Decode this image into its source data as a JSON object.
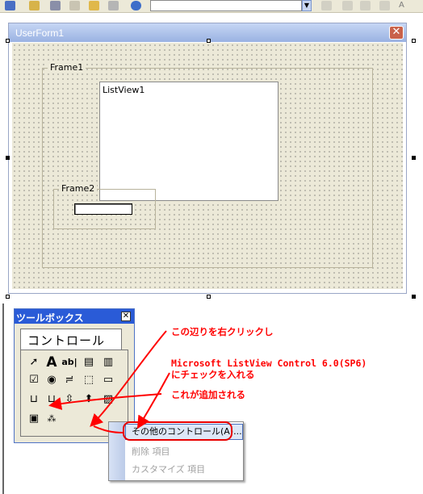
{
  "toolbar": {
    "icons": [
      "form-icon",
      "edit-icon",
      "wrench-icon",
      "properties-icon",
      "folder-icon",
      "cut-icon",
      "help-icon"
    ],
    "right_icons": [
      "align-left-icon",
      "align-right-icon",
      "align-top-icon",
      "font-size-icon"
    ],
    "font_size_glyph": "A",
    "dropdown_glyph": "▼"
  },
  "userform": {
    "title": "UserForm1",
    "close_glyph": "✕",
    "frame1_label": "Frame1",
    "listview_label": "ListView1",
    "frame2_label": "Frame2"
  },
  "toolbox": {
    "title": "ツールボックス",
    "close_glyph": "✕",
    "tab_label": "コントロール",
    "tools": [
      {
        "name": "pointer-tool",
        "glyph": "➚"
      },
      {
        "name": "label-tool",
        "glyph": "A"
      },
      {
        "name": "textbox-tool",
        "glyph": "ab|"
      },
      {
        "name": "combobox-tool",
        "glyph": "▤"
      },
      {
        "name": "listbox-tool",
        "glyph": "▥"
      },
      {
        "name": "checkbox-tool",
        "glyph": "☑"
      },
      {
        "name": "option-button-tool",
        "glyph": "◉"
      },
      {
        "name": "toggle-button-tool",
        "glyph": "≓"
      },
      {
        "name": "frame-tool",
        "glyph": "⬚"
      },
      {
        "name": "command-button-tool",
        "glyph": "▭"
      },
      {
        "name": "tabstrip-tool",
        "glyph": "⊔"
      },
      {
        "name": "multipage-tool",
        "glyph": "⊔"
      },
      {
        "name": "scrollbar-tool",
        "glyph": "⇳"
      },
      {
        "name": "spin-button-tool",
        "glyph": "⬍"
      },
      {
        "name": "image-tool",
        "glyph": "▨"
      },
      {
        "name": "refedit-tool",
        "glyph": "▣"
      },
      {
        "name": "listview-tool",
        "glyph": "⁂"
      }
    ]
  },
  "context_menu": {
    "items": [
      {
        "label": "その他のコントロール(A)...",
        "enabled": true
      },
      {
        "label": "削除 項目",
        "enabled": false
      },
      {
        "label": "カスタマイズ 項目",
        "enabled": false
      }
    ]
  },
  "annotations": {
    "note1": "この辺りを右クリックし",
    "note2_line1": "Microsoft ListView Control 6.0(SP6)",
    "note2_line2": "にチェックを入れる",
    "note3": "これが追加される",
    "color": "#ff0000"
  },
  "colors": {
    "form_bg": "#ece9d8",
    "toolbox_title": "#2a5bd7",
    "highlight_border": "#e80000"
  }
}
